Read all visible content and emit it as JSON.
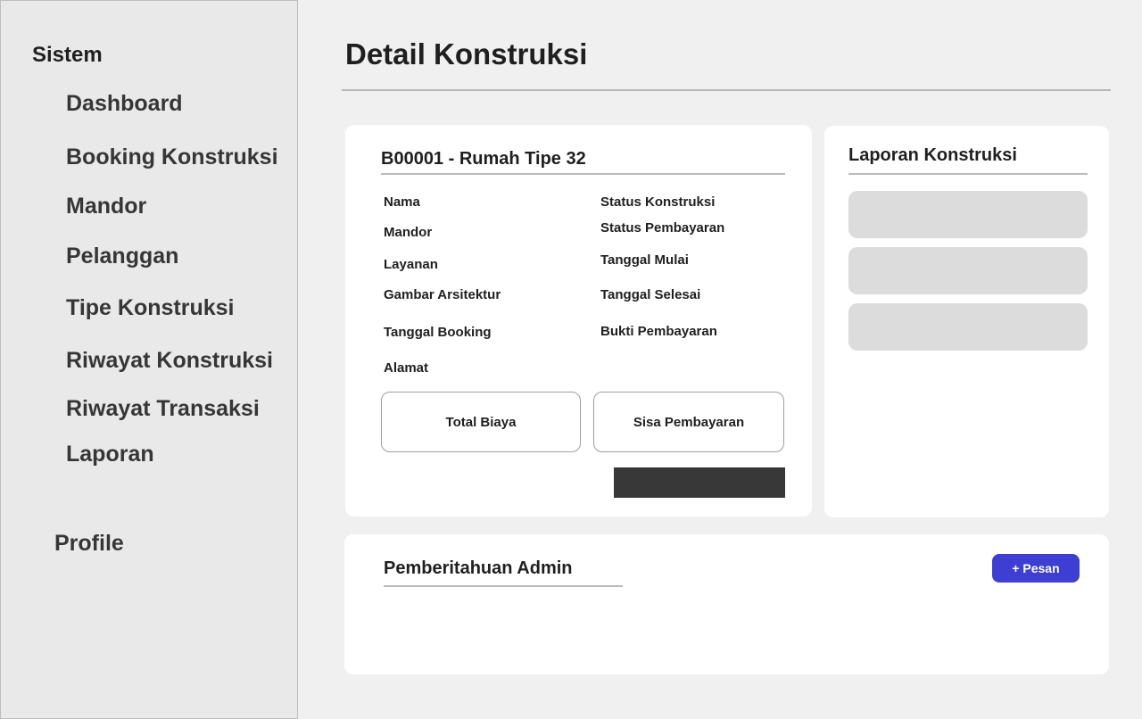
{
  "sidebar": {
    "heading": "Sistem",
    "items": [
      {
        "label": "Dashboard"
      },
      {
        "label": "Booking Konstruksi"
      },
      {
        "label": "Mandor"
      },
      {
        "label": "Pelanggan"
      },
      {
        "label": "Tipe Konstruksi"
      },
      {
        "label": "Riwayat Konstruksi"
      },
      {
        "label": "Riwayat Transaksi"
      },
      {
        "label": "Laporan"
      }
    ],
    "profile": "Profile"
  },
  "page": {
    "title": "Detail Konstruksi"
  },
  "detail": {
    "booking_title": "B00001 - Rumah Tipe 32",
    "left_fields": [
      "Nama",
      "Mandor",
      "Layanan",
      "Gambar Arsitektur",
      "Tanggal Booking",
      "Alamat"
    ],
    "right_fields": [
      "Status Konstruksi",
      "Status Pembayaran",
      "Tanggal Mulai",
      "Tanggal Selesai",
      "Bukti Pembayaran"
    ],
    "total_biaya": "Total Biaya",
    "sisa_pembayaran": "Sisa Pembayaran"
  },
  "report": {
    "title": "Laporan Konstruksi"
  },
  "notifications": {
    "title": "Pemberitahuan Admin",
    "button": "+ Pesan"
  },
  "colors": {
    "accent": "#3e3fd2",
    "action_bar": "#383838"
  }
}
